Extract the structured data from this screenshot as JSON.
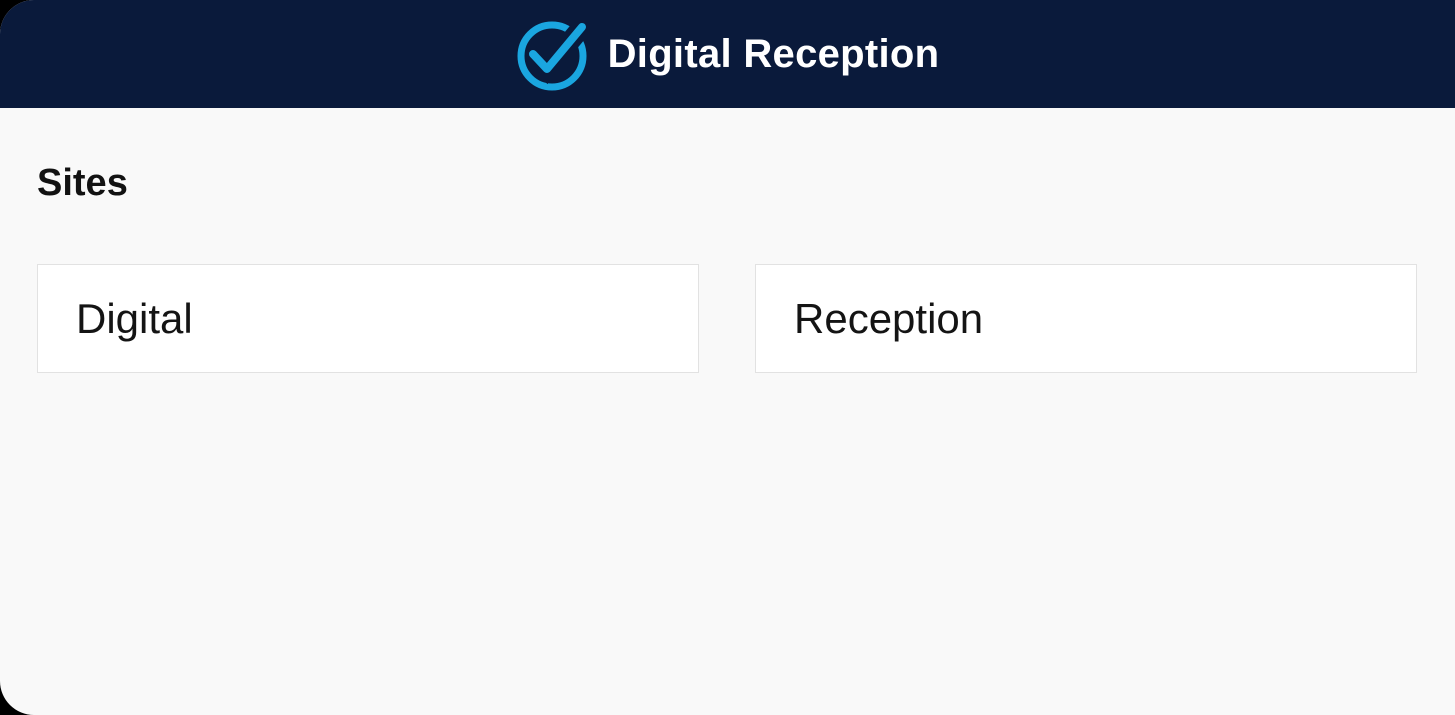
{
  "header": {
    "title": "Digital Reception",
    "logo_icon": "check-circle-icon",
    "background_color": "#0a1a3b",
    "accent_color": "#1aa6e0"
  },
  "main": {
    "section_title": "Sites",
    "sites": [
      {
        "label": "Digital"
      },
      {
        "label": "Reception"
      }
    ]
  }
}
